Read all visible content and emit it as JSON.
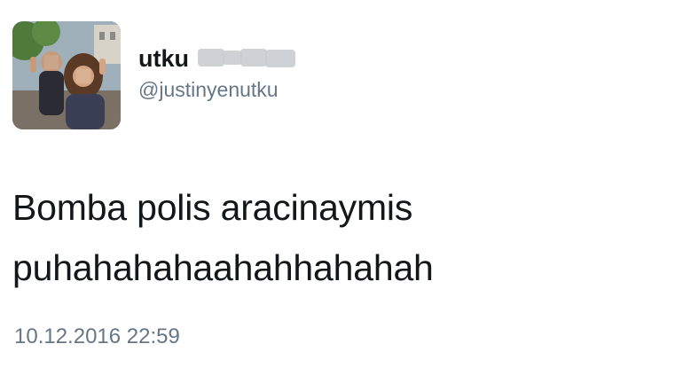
{
  "tweet": {
    "author": {
      "display_name": "utku",
      "handle": "@justinyenutku",
      "avatar_icon": "profile-photo"
    },
    "text_lines": [
      "Bomba polis aracinaymis",
      "puhahahahaahahhahahah"
    ],
    "timestamp": "10.12.2016 22:59"
  },
  "colors": {
    "text_primary": "#14171a",
    "text_secondary": "#657786",
    "background": "#ffffff"
  }
}
